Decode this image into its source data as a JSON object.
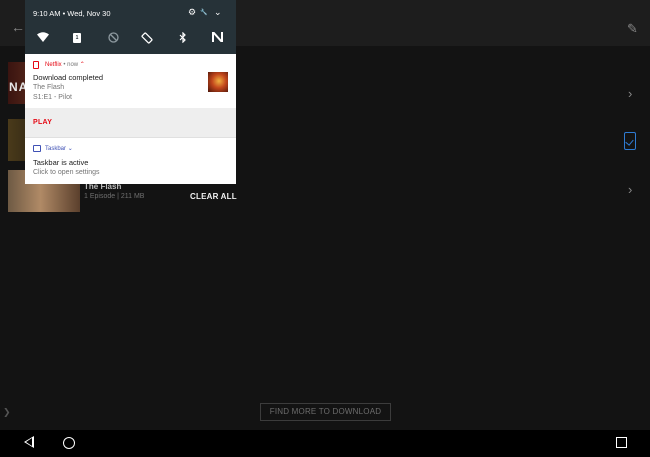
{
  "status": {
    "time_date": "9:10 AM • Wed, Nov 30"
  },
  "quick_settings": {
    "icons": [
      "wifi-icon",
      "sim-icon",
      "do-not-disturb-icon",
      "auto-rotate-icon",
      "bluetooth-icon",
      "nfc-icon"
    ],
    "sim_label": "1"
  },
  "notifications": [
    {
      "app": "Netflix",
      "meta": "• now",
      "title": "Download completed",
      "line1": "The Flash",
      "line2": "S1:E1 - Pilot",
      "action": "PLAY",
      "accent": "#e50914"
    },
    {
      "app": "Taskbar",
      "title": "Taskbar is active",
      "subtitle": "Click to open settings",
      "accent": "#3f51b5"
    }
  ],
  "shade": {
    "clear_all": "CLEAR ALL"
  },
  "app": {
    "thumb_text": "NA",
    "row_title": "The Flash",
    "row_meta": "1 Episode | 211 MB",
    "find_more": "FIND MORE TO DOWNLOAD"
  }
}
